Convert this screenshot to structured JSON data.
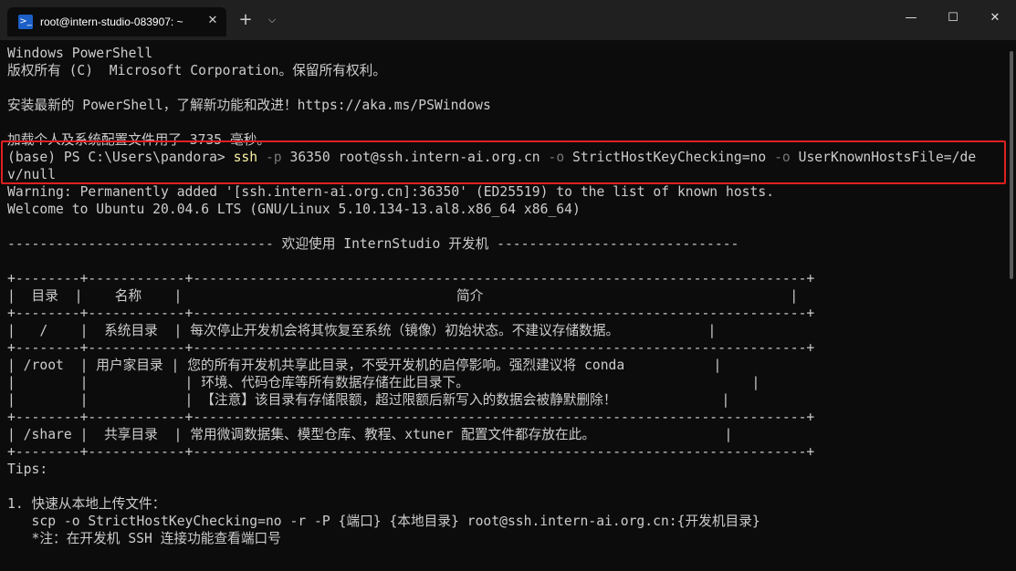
{
  "window": {
    "tab_title": "root@intern-studio-083907: ~",
    "tab_close": "✕",
    "new_tab": "+",
    "dropdown": "⌵",
    "minimize": "—",
    "maximize": "☐",
    "close": "✕"
  },
  "terminal": {
    "lines": [
      "Windows PowerShell",
      "版权所有 (C)  Microsoft Corporation。保留所有权利。",
      "",
      "安装最新的 PowerShell，了解新功能和改进！https://aka.ms/PSWindows",
      "",
      "加载个人及系统配置文件用了 3735 毫秒。",
      "",
      "",
      "Warning: Permanently added '[ssh.intern-ai.org.cn]:36350' (ED25519) to the list of known hosts.",
      "Welcome to Ubuntu 20.04.6 LTS (GNU/Linux 5.10.134-13.al8.x86_64 x86_64)",
      "",
      "--------------------------------- 欢迎使用 InternStudio 开发机 ------------------------------",
      "",
      "+--------+------------+----------------------------------------------------------------------------+",
      "|  目录  |    名称    |                                  简介                                      |",
      "+--------+------------+----------------------------------------------------------------------------+",
      "|   /    |  系统目录  | 每次停止开发机会将其恢复至系统（镜像）初始状态。不建议存储数据。           |",
      "+--------+------------+----------------------------------------------------------------------------+",
      "| /root  | 用户家目录 | 您的所有开发机共享此目录，不受开发机的启停影响。强烈建议将 conda           |",
      "|        |            | 环境、代码仓库等所有数据存储在此目录下。                                   |",
      "|        |            | 【注意】该目录有存储限额，超过限额后新写入的数据会被静默删除！             |",
      "+--------+------------+----------------------------------------------------------------------------+",
      "| /share |  共享目录  | 常用微调数据集、模型仓库、教程、xtuner 配置文件都存放在此。                |",
      "+--------+------------+----------------------------------------------------------------------------+",
      "Tips:",
      "",
      "1. 快速从本地上传文件：",
      "   scp -o StrictHostKeyChecking=no -r -P {端口} {本地目录} root@ssh.intern-ai.org.cn:{开发机目录}",
      "   *注：在开发机 SSH 连接功能查看端口号"
    ],
    "prompt": "(base) PS C:\\Users\\pandora> ",
    "command": "ssh",
    "arg_p_flag": " -p ",
    "arg_port": "36350",
    "arg_host": " root@ssh.intern-ai.org.cn ",
    "arg_o1_flag": "-o",
    "arg_o1_val": " StrictHostKeyChecking=no ",
    "arg_o2_flag": "-o",
    "arg_o2_val": " UserKnownHostsFile=/de",
    "wrap": "v/null"
  }
}
